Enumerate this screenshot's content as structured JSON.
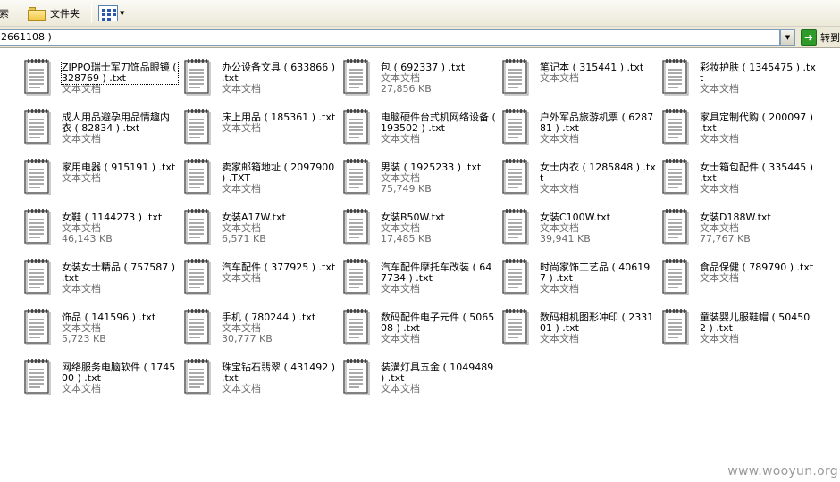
{
  "toolbar": {
    "search_label": "搜索",
    "folders_label": "文件夹"
  },
  "address": {
    "value": "2661108 )",
    "go_label": "转到"
  },
  "files": [
    {
      "name": "ZIPPO瑞士军刀饰品眼镜 ( 328769 ) .txt",
      "type": "文本文档",
      "size": ""
    },
    {
      "name": "办公设备文具 ( 633866 ) .txt",
      "type": "文本文档",
      "size": ""
    },
    {
      "name": "包 ( 692337 ) .txt",
      "type": "文本文档",
      "size": "27,856 KB"
    },
    {
      "name": "笔记本 ( 315441 ) .txt",
      "type": "文本文档",
      "size": ""
    },
    {
      "name": "彩妆护肤 ( 1345475 ) .txt",
      "type": "文本文档",
      "size": ""
    },
    {
      "name": "成人用品避孕用品情趣内衣 ( 82834 ) .txt",
      "type": "文本文档",
      "size": ""
    },
    {
      "name": "床上用品 ( 185361 ) .txt",
      "type": "文本文档",
      "size": ""
    },
    {
      "name": "电脑硬件台式机网络设备 ( 193502 ) .txt",
      "type": "文本文档",
      "size": ""
    },
    {
      "name": "户外军品旅游机票 ( 628781 ) .txt",
      "type": "文本文档",
      "size": ""
    },
    {
      "name": "家具定制代购 ( 200097 ) .txt",
      "type": "文本文档",
      "size": ""
    },
    {
      "name": "家用电器 ( 915191 ) .txt",
      "type": "文本文档",
      "size": ""
    },
    {
      "name": "卖家邮箱地址 ( 2097900 ) .TXT",
      "type": "文本文档",
      "size": ""
    },
    {
      "name": "男装 ( 1925233 ) .txt",
      "type": "文本文档",
      "size": "75,749 KB"
    },
    {
      "name": "女士内衣 ( 1285848 ) .txt",
      "type": "文本文档",
      "size": ""
    },
    {
      "name": "女士箱包配件 ( 335445 ) .txt",
      "type": "文本文档",
      "size": ""
    },
    {
      "name": "女鞋 ( 1144273 ) .txt",
      "type": "文本文档",
      "size": "46,143 KB"
    },
    {
      "name": "女装A17W.txt",
      "type": "文本文档",
      "size": "6,571 KB"
    },
    {
      "name": "女装B50W.txt",
      "type": "文本文档",
      "size": "17,485 KB"
    },
    {
      "name": "女装C100W.txt",
      "type": "文本文档",
      "size": "39,941 KB"
    },
    {
      "name": "女装D188W.txt",
      "type": "文本文档",
      "size": "77,767 KB"
    },
    {
      "name": "女装女士精品 ( 757587 ) .txt",
      "type": "文本文档",
      "size": ""
    },
    {
      "name": "汽车配件 ( 377925 ) .txt",
      "type": "文本文档",
      "size": ""
    },
    {
      "name": "汽车配件摩托车改装 ( 647734 ) .txt",
      "type": "文本文档",
      "size": ""
    },
    {
      "name": "时尚家饰工艺品 ( 406197 ) .txt",
      "type": "文本文档",
      "size": ""
    },
    {
      "name": "食品保健 ( 789790 ) .txt",
      "type": "文本文档",
      "size": ""
    },
    {
      "name": "饰品 ( 141596 ) .txt",
      "type": "文本文档",
      "size": "5,723 KB"
    },
    {
      "name": "手机 ( 780244 ) .txt",
      "type": "文本文档",
      "size": "30,777 KB"
    },
    {
      "name": "数码配件电子元件 ( 506508 ) .txt",
      "type": "文本文档",
      "size": ""
    },
    {
      "name": "数码相机图形冲印 ( 233101 ) .txt",
      "type": "文本文档",
      "size": ""
    },
    {
      "name": "童装婴儿服鞋帽 ( 504502 ) .txt",
      "type": "文本文档",
      "size": ""
    },
    {
      "name": "网络服务电脑软件 ( 174500 ) .txt",
      "type": "文本文档",
      "size": ""
    },
    {
      "name": "珠宝钻石翡翠 ( 431492 ) .txt",
      "type": "文本文档",
      "size": ""
    },
    {
      "name": "装潢灯具五金 ( 1049489 ) .txt",
      "type": "文本文档",
      "size": ""
    }
  ],
  "watermark": "www.wooyun.org"
}
